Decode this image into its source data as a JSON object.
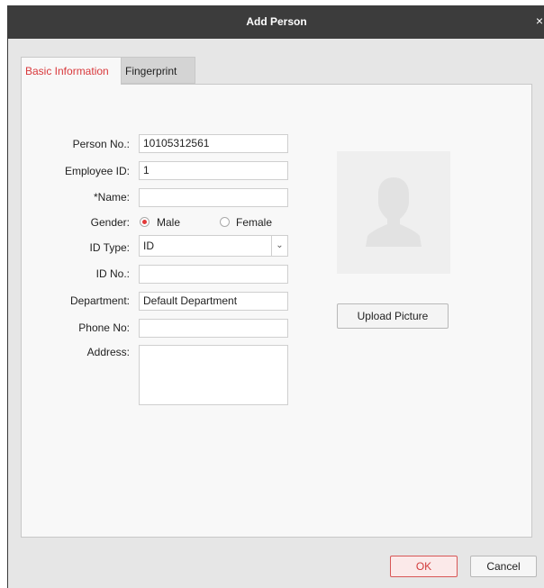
{
  "dialog": {
    "title": "Add Person",
    "close_glyph": "×"
  },
  "tabs": [
    {
      "label": "Basic Information",
      "active": true
    },
    {
      "label": "Fingerprint",
      "active": false
    }
  ],
  "form": {
    "person_no": {
      "label": "Person No.:",
      "value": "10105312561"
    },
    "employee_id": {
      "label": "Employee ID:",
      "value": "1"
    },
    "name": {
      "label": "*Name:",
      "value": ""
    },
    "gender": {
      "label": "Gender:",
      "options": [
        "Male",
        "Female"
      ],
      "selected": "Male"
    },
    "id_type": {
      "label": "ID Type:",
      "value": "ID"
    },
    "id_no": {
      "label": "ID No.:",
      "value": ""
    },
    "department": {
      "label": "Department:",
      "value": "Default Department"
    },
    "phone_no": {
      "label": "Phone No:",
      "value": ""
    },
    "address": {
      "label": "Address:",
      "value": ""
    }
  },
  "photo": {
    "icon": "person-placeholder-icon"
  },
  "upload_label": "Upload Picture",
  "footer": {
    "ok_label": "OK",
    "cancel_label": "Cancel"
  },
  "colors": {
    "accent": "#d9393c",
    "titlebar": "#3c3c3c",
    "background": "#e6e6e6"
  }
}
